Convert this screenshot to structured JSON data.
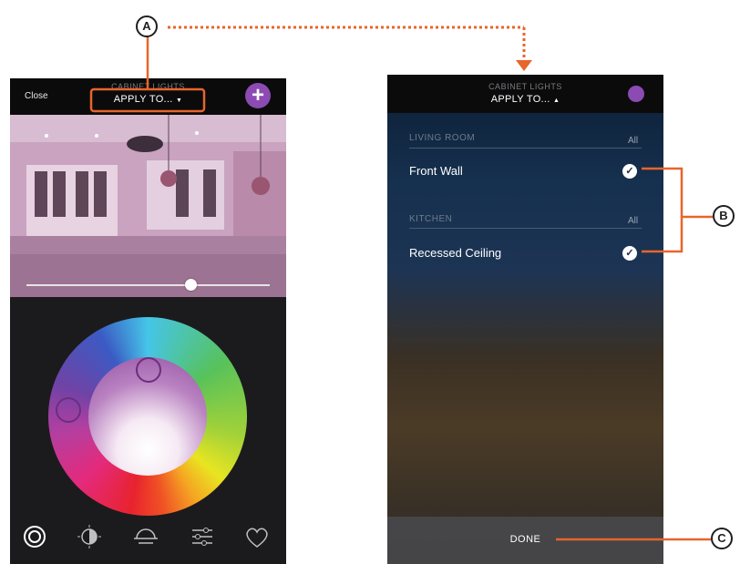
{
  "left_phone": {
    "close_label": "Close",
    "group_label": "CABINET LIGHTS",
    "apply_label": "APPLY TO...",
    "apply_arrow": "▼",
    "add_icon": "+",
    "brightness_level": 0.68,
    "toolbar": [
      {
        "name": "color-wheel-icon"
      },
      {
        "name": "white-tone-icon"
      },
      {
        "name": "scene-icon"
      },
      {
        "name": "adjust-sliders-icon"
      },
      {
        "name": "favorite-heart-icon"
      }
    ]
  },
  "right_phone": {
    "group_label": "CABINET LIGHTS",
    "apply_label": "APPLY TO...",
    "apply_arrow": "▲",
    "sections": [
      {
        "title": "LIVING ROOM",
        "all_label": "All",
        "items": [
          {
            "label": "Front Wall",
            "checked": true
          }
        ]
      },
      {
        "title": "KITCHEN",
        "all_label": "All",
        "items": [
          {
            "label": "Recessed Ceiling",
            "checked": true
          }
        ]
      }
    ],
    "done_label": "DONE"
  },
  "callouts": {
    "a": "A",
    "b": "B",
    "c": "C"
  },
  "colors": {
    "accent": "#8b4bb3",
    "annotation": "#e8652b"
  }
}
